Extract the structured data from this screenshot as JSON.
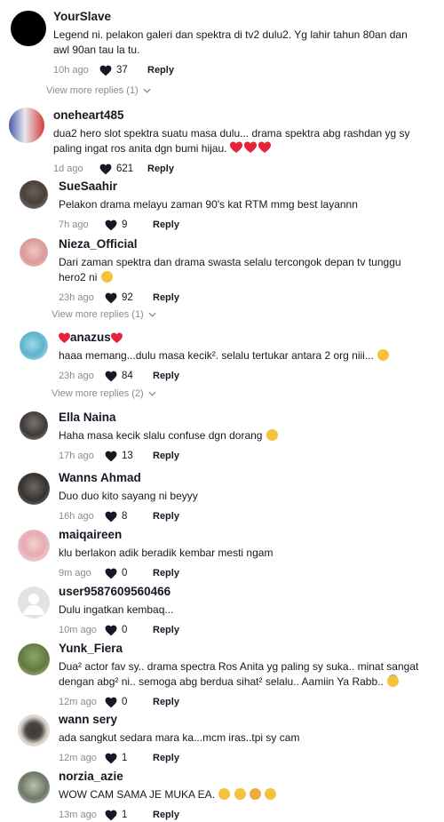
{
  "comments": [
    {
      "username": "YourSlave",
      "text": "Legend ni. pelakon galeri dan spektra di tv2 dulu2. Yg lahir tahun 80an dan awl 90an tau la tu.",
      "time": "10h ago",
      "likes": "37",
      "reply_label": "Reply",
      "more_replies": "View more replies (1)"
    },
    {
      "username": "oneheart485",
      "text": "dua2 hero slot spektra suatu masa dulu... drama spektra abg rashdan yg sy paling ingat ros anita dgn bumi hijau.",
      "time": "1d ago",
      "likes": "621",
      "reply_label": "Reply"
    },
    {
      "username": "SueSaahir",
      "text": "Pelakon drama melayu zaman 90's kat RTM mmg best layannn",
      "time": "7h ago",
      "likes": "9",
      "reply_label": "Reply"
    },
    {
      "username": "Nieza_Official",
      "text": "Dari zaman spektra dan drama swasta selalu tercongok depan tv tunggu hero2 ni",
      "time": "23h ago",
      "likes": "92",
      "reply_label": "Reply",
      "more_replies": "View more replies (1)"
    },
    {
      "username": "anazus",
      "text": "haaa memang...dulu masa kecik². selalu tertukar antara 2 org niii...",
      "time": "23h ago",
      "likes": "84",
      "reply_label": "Reply",
      "more_replies": "View more replies (2)"
    },
    {
      "username": "Ella Naina",
      "text": "Haha masa kecik slalu confuse dgn dorang",
      "time": "17h ago",
      "likes": "13",
      "reply_label": "Reply"
    },
    {
      "username": "Wanns Ahmad",
      "text": "Duo duo kito sayang ni beyyy",
      "time": "16h ago",
      "likes": "8",
      "reply_label": "Reply"
    },
    {
      "username": "maiqaireen",
      "text": "klu berlakon adik beradik kembar mesti ngam",
      "time": "9m ago",
      "likes": "0",
      "reply_label": "Reply"
    },
    {
      "username": "user9587609560466",
      "text": "Dulu ingatkan kembaq...",
      "time": "10m ago",
      "likes": "0",
      "reply_label": "Reply"
    },
    {
      "username": "Yunk_Fiera",
      "text": "Dua² actor fav sy.. drama spectra Ros Anita yg paling sy suka.. minat sangat dengan abg² ni.. semoga abg berdua sihat² selalu.. Aamiin Ya Rabb..",
      "time": "12m ago",
      "likes": "0",
      "reply_label": "Reply"
    },
    {
      "username": "wann sery",
      "text": "ada sangkut sedara mara ka...mcm iras..tpi sy cam",
      "time": "12m ago",
      "likes": "1",
      "reply_label": "Reply"
    },
    {
      "username": "norzia_azie",
      "text": "WOW CAM SAMA JE MUKA EA.",
      "time": "13m ago",
      "likes": "1",
      "reply_label": "Reply"
    }
  ],
  "colors": {
    "text": "#161823",
    "muted": "#8a8b91",
    "heart_emoji": "#e5243b",
    "emoji_yellow": "#f7c23b"
  }
}
